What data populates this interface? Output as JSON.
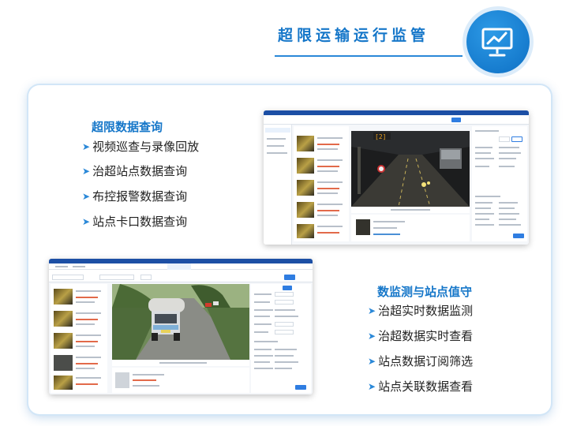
{
  "header": {
    "title": "超限运输运行监管",
    "icon": "monitor-chart-icon",
    "accent_color": "#1677c9"
  },
  "section_left": {
    "title": "超限数据查询",
    "items": [
      "视频巡查与录像回放",
      "治超站点数据查询",
      "布控报警数据查询",
      "站点卡口数据查询"
    ]
  },
  "section_right": {
    "title": "数监测与站点值守",
    "items": [
      "治超实时数据监测",
      "治超数据实时查看",
      "站点数据订阅筛选",
      "站点关联数据查看"
    ]
  },
  "screenshots": [
    {
      "name": "dashboard-screenshot-top",
      "content": "highway-night-video"
    },
    {
      "name": "dashboard-screenshot-bottom",
      "content": "truck-road-video"
    }
  ]
}
